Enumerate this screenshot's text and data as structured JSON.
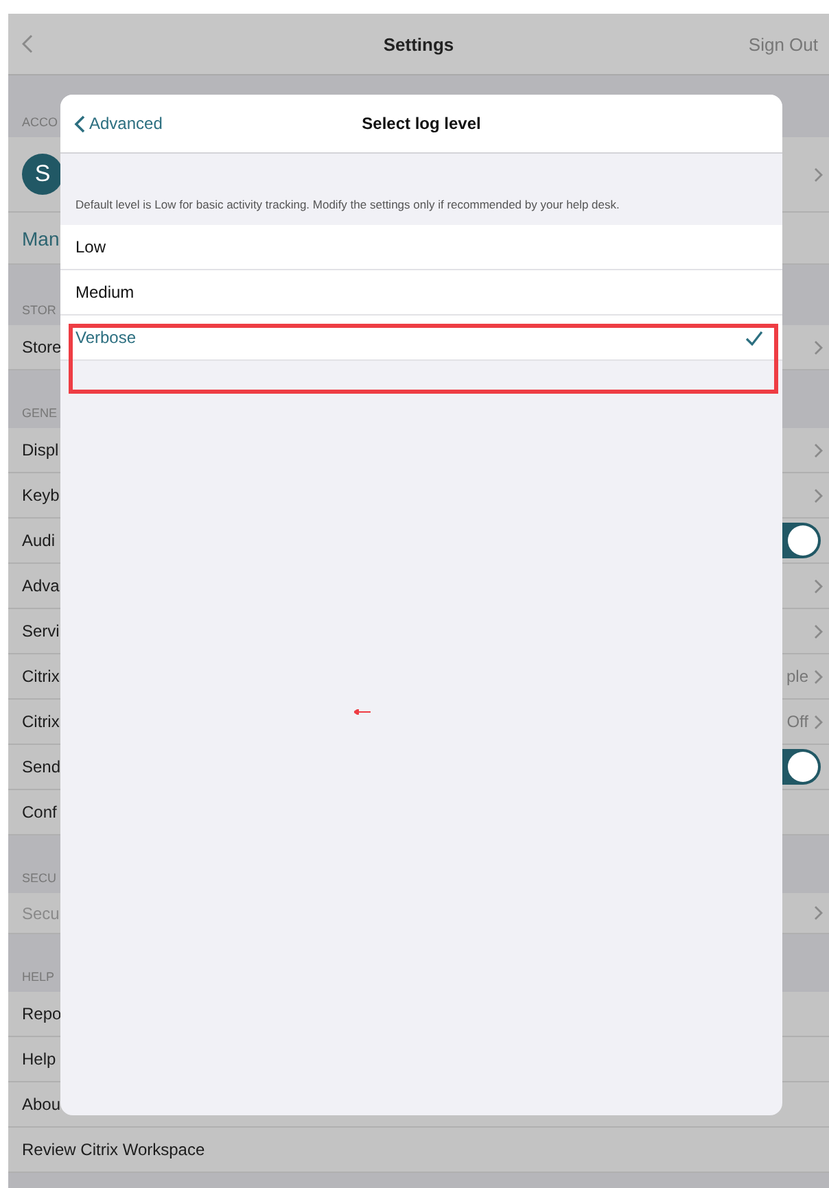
{
  "nav": {
    "title": "Settings",
    "action": "Sign Out"
  },
  "sections": [
    {
      "label": "ACCO",
      "rows": [
        {
          "kind": "account",
          "avatar": "S",
          "chevron": true
        },
        {
          "kind": "link",
          "label": "Man"
        }
      ]
    },
    {
      "label": "STOR",
      "rows": [
        {
          "kind": "plain",
          "label": "Store",
          "chevron": true
        }
      ]
    },
    {
      "label": "GENE",
      "rows": [
        {
          "kind": "plain",
          "label": "Displ",
          "chevron": true
        },
        {
          "kind": "plain",
          "label": "Keyb",
          "chevron": true
        },
        {
          "kind": "toggle",
          "label": "Audi",
          "on": true
        },
        {
          "kind": "plain",
          "label": "Adva",
          "chevron": true
        },
        {
          "kind": "plain",
          "label": "Servi",
          "chevron": true
        },
        {
          "kind": "plain",
          "label": "Citrix",
          "value": "ple",
          "chevron": true
        },
        {
          "kind": "plain",
          "label": "Citrix",
          "value": "Off",
          "chevron": true
        },
        {
          "kind": "toggle",
          "label": "Send",
          "on": true
        },
        {
          "kind": "plain",
          "label": "Conf"
        }
      ]
    },
    {
      "label": "SECU",
      "rows": [
        {
          "kind": "plain",
          "label": "Secu",
          "chevron": true,
          "disabled": true
        }
      ]
    },
    {
      "label": "HELP",
      "rows": [
        {
          "kind": "plain",
          "label": "Repo"
        },
        {
          "kind": "plain",
          "label": "Help"
        },
        {
          "kind": "plain",
          "label": "Abou"
        },
        {
          "kind": "plain",
          "label": "Review Citrix Workspace"
        }
      ]
    }
  ],
  "modal": {
    "back": "Advanced",
    "title": "Select log level",
    "description": "Default level is Low for basic activity tracking. Modify the settings only if recommended by your help desk.",
    "options": [
      {
        "label": "Low",
        "selected": false
      },
      {
        "label": "Medium",
        "selected": false
      },
      {
        "label": "Verbose",
        "selected": true
      }
    ]
  }
}
